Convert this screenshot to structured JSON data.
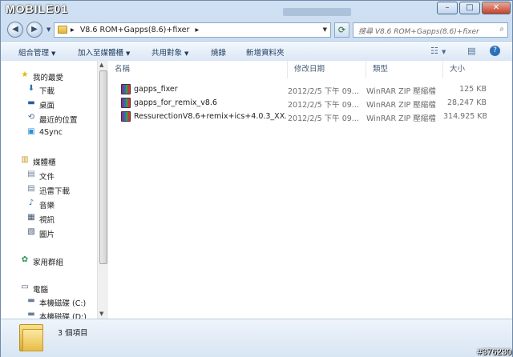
{
  "window": {
    "logo": "MOBILE01",
    "btn_min": "–",
    "btn_max": "□",
    "btn_close": "✕"
  },
  "address": {
    "back": "◀",
    "forward": "▶",
    "sep1": "▸",
    "path": "V8.6 ROM+Gapps(8.6)+fixer",
    "sep2": "▸",
    "refresh": "⟳",
    "search_placeholder": "搜尋 V8.6 ROM+Gapps(8.6)+fixer",
    "search_icon": "⌕"
  },
  "toolbar": {
    "organize": "組合管理",
    "include_library": "加入至媒體櫃",
    "share_with": "共用對象",
    "burn": "燒錄",
    "new_folder": "新增資料夾",
    "view_icon": "☷",
    "preview_icon": "▤",
    "help_icon": "?"
  },
  "sidebar": {
    "favorites": {
      "label": "我的最愛",
      "icon": "★"
    },
    "fav_items": [
      {
        "label": "下載",
        "icon": "⬇"
      },
      {
        "label": "桌面",
        "icon": "▬"
      },
      {
        "label": "最近的位置",
        "icon": "⟲"
      },
      {
        "label": "4Sync",
        "icon": "▣"
      }
    ],
    "libraries": {
      "label": "媒體櫃",
      "icon": "▥"
    },
    "lib_items": [
      {
        "label": "文件",
        "icon": "▤"
      },
      {
        "label": "迅雷下載",
        "icon": "▤"
      },
      {
        "label": "音樂",
        "icon": "♪"
      },
      {
        "label": "視訊",
        "icon": "▦"
      },
      {
        "label": "圖片",
        "icon": "▧"
      }
    ],
    "homegroup": {
      "label": "家用群組",
      "icon": "✿"
    },
    "computer": {
      "label": "電腦",
      "icon": "▭"
    },
    "drives": [
      {
        "label": "本機磁碟 (C:)",
        "icon": "▬"
      },
      {
        "label": "本機磁碟 (D:)",
        "icon": "▬"
      }
    ]
  },
  "columns": {
    "name": "名稱",
    "date": "修改日期",
    "type": "類型",
    "size": "大小"
  },
  "files": [
    {
      "name": "gapps_fixer",
      "date": "2012/2/5 下午 09...",
      "type": "WinRAR ZIP 壓縮檔",
      "size": "125 KB"
    },
    {
      "name": "gapps_for_remix_v8.6",
      "date": "2012/2/5 下午 09...",
      "type": "WinRAR ZIP 壓縮檔",
      "size": "28,247 KB"
    },
    {
      "name": "RessurectionV8.6+remix+ics+4.0.3_XX...",
      "date": "2012/2/5 下午 09...",
      "type": "WinRAR ZIP 壓縮檔",
      "size": "314,925 KB"
    }
  ],
  "status": {
    "count": "3 個項目"
  },
  "watermark": "#376230"
}
